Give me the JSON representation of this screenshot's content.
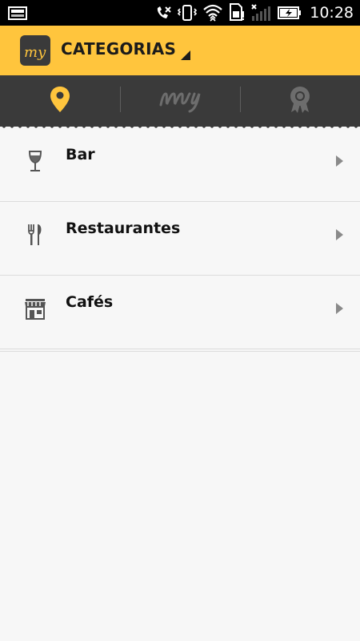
{
  "status_bar": {
    "time": "10:28",
    "icons": [
      "notification-image-icon",
      "missed-call-icon",
      "vibrate-icon",
      "wifi-icon",
      "sim-icon",
      "signal-icon",
      "battery-charging-icon"
    ]
  },
  "app_bar": {
    "logo_text": "my",
    "title": "CATEGORIAS",
    "color": "#ffc53d"
  },
  "tabs": [
    {
      "icon": "location-pin-icon",
      "active": true
    },
    {
      "icon": "my-logo-icon",
      "active": false
    },
    {
      "icon": "award-badge-icon",
      "active": false
    }
  ],
  "categories": [
    {
      "label": "Bar",
      "icon": "wine-glass-icon"
    },
    {
      "label": "Restaurantes",
      "icon": "fork-knife-icon"
    },
    {
      "label": "Cafés",
      "icon": "store-icon"
    }
  ]
}
